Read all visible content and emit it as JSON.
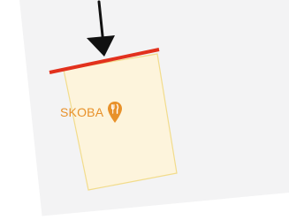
{
  "map": {
    "colors": {
      "background": "#f3f3f4",
      "road": "#ffffff",
      "parcel_fill": "#fdf4dc",
      "parcel_stroke": "#f2dc8c",
      "highlight_edge": "#e2311d",
      "arrow": "#111111",
      "poi_accent": "#e8912a"
    },
    "poi": {
      "name": "SKOBA",
      "category_icon": "restaurant-icon"
    }
  }
}
